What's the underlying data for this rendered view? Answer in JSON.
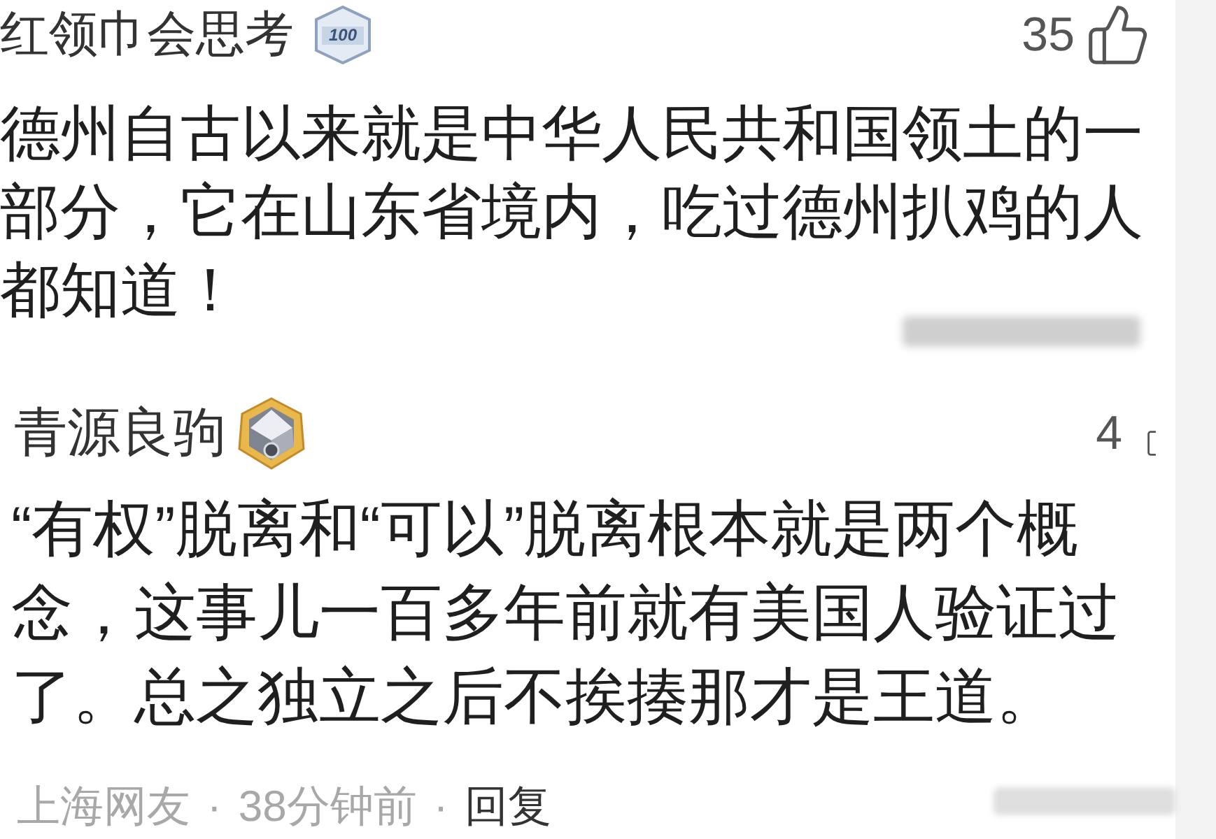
{
  "comments": [
    {
      "username": "红领巾会思考",
      "badge": {
        "kind": "level",
        "text": "100"
      },
      "likes": "35",
      "like_icon_cropped": false,
      "text": "德州自古以来就是中华人民共和国领土的一部分，它在山东省境内，吃过德州扒鸡的人都知道！",
      "meta_blurred": true
    },
    {
      "username": "青源良驹",
      "badge": {
        "kind": "medal"
      },
      "likes": "4",
      "like_icon_cropped": true,
      "text": "“有权”脱离和“可以”脱离根本就是两个概念，这事儿一百多年前就有美国人验证过了。总之独立之后不挨揍那才是王道。",
      "meta_blurred": true,
      "footer": [
        {
          "kind": "meta",
          "text": "上海网友"
        },
        {
          "kind": "separator",
          "text": "·"
        },
        {
          "kind": "meta",
          "text": "38分钟前"
        },
        {
          "kind": "separator",
          "text": "·"
        },
        {
          "kind": "action",
          "text": "回复"
        }
      ]
    }
  ]
}
